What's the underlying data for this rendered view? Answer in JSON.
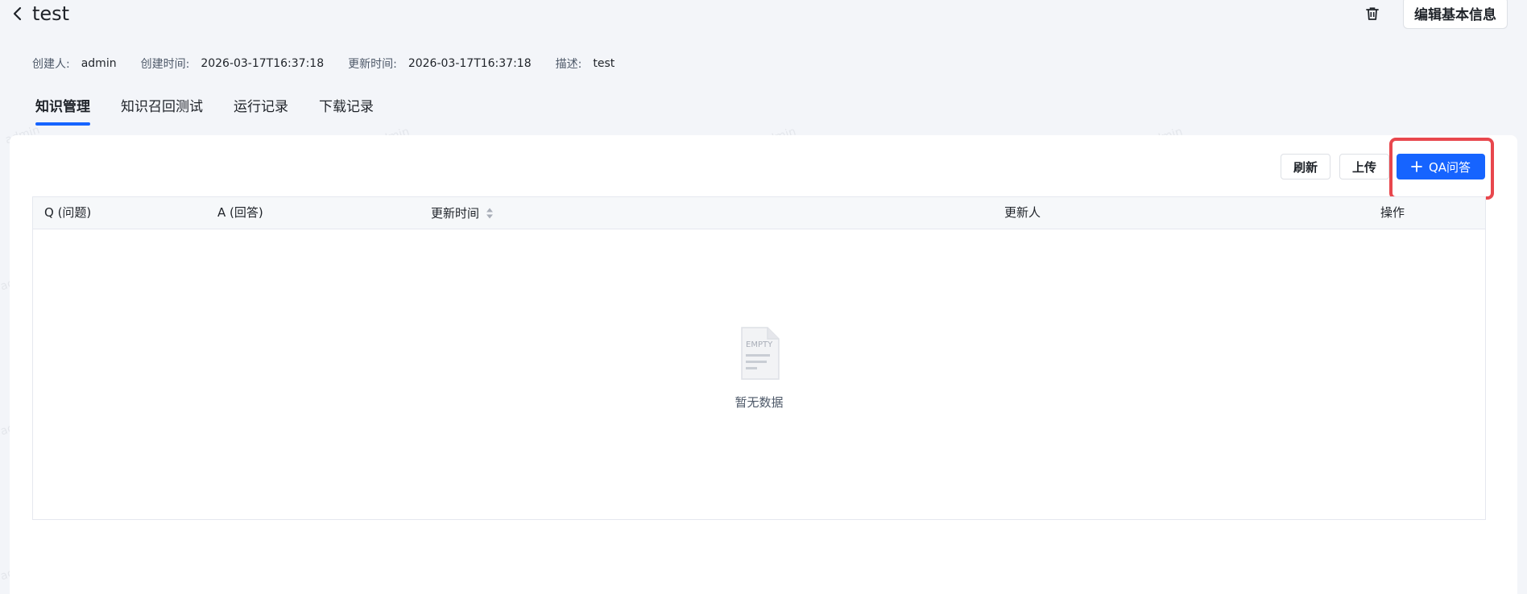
{
  "header": {
    "title": "test",
    "back_icon": "chevron-left-icon",
    "delete_icon": "trash-icon",
    "edit_button": "编辑基本信息"
  },
  "meta": {
    "creator_label": "创建人:",
    "creator_value": "admin",
    "created_label": "创建时间:",
    "created_value": "2026-03-17T16:37:18",
    "updated_label": "更新时间:",
    "updated_value": "2026-03-17T16:37:18",
    "desc_label": "描述:",
    "desc_value": "test"
  },
  "tabs": [
    {
      "label": "知识管理",
      "active": true
    },
    {
      "label": "知识召回测试",
      "active": false
    },
    {
      "label": "运行记录",
      "active": false
    },
    {
      "label": "下载记录",
      "active": false
    }
  ],
  "toolbar": {
    "refresh": "刷新",
    "upload": "上传",
    "add_qa": "QA问答"
  },
  "table": {
    "columns": [
      "Q (问题)",
      "A (回答)",
      "更新时间",
      "更新人",
      "操作"
    ],
    "rows": [],
    "empty_text": "暂无数据",
    "empty_icon_text": "EMPTY"
  },
  "watermark": "admin",
  "colors": {
    "primary": "#1664ff",
    "highlight": "#e8474d",
    "background": "#f3f5f9"
  }
}
